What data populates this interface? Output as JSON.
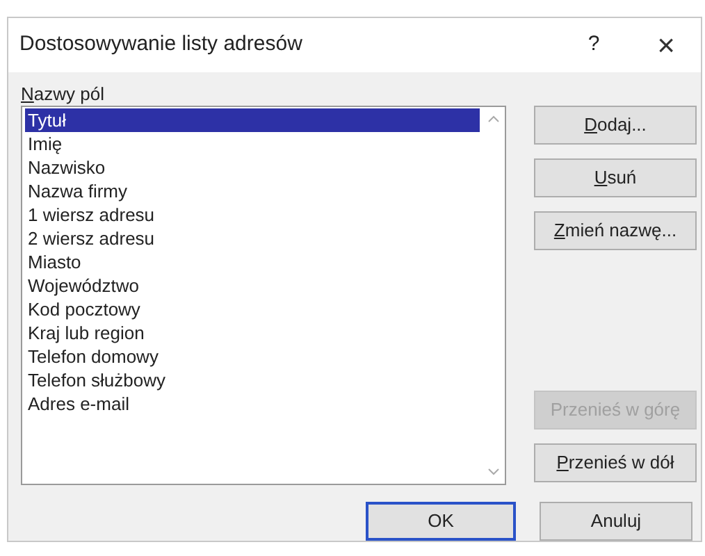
{
  "window": {
    "title": "Dostosowywanie listy adresów",
    "help": "?",
    "close": "×"
  },
  "fields_label": {
    "text": "Nazwy pól",
    "mnemonic": true
  },
  "fields": [
    {
      "label": "Tytuł",
      "selected": true
    },
    {
      "label": "Imię",
      "selected": false
    },
    {
      "label": "Nazwisko",
      "selected": false
    },
    {
      "label": "Nazwa firmy",
      "selected": false
    },
    {
      "label": "1 wiersz adresu",
      "selected": false
    },
    {
      "label": "2 wiersz adresu",
      "selected": false
    },
    {
      "label": "Miasto",
      "selected": false
    },
    {
      "label": "Województwo",
      "selected": false
    },
    {
      "label": "Kod pocztowy",
      "selected": false
    },
    {
      "label": "Kraj lub region",
      "selected": false
    },
    {
      "label": "Telefon domowy",
      "selected": false
    },
    {
      "label": "Telefon służbowy",
      "selected": false
    },
    {
      "label": "Adres e-mail",
      "selected": false
    }
  ],
  "side_buttons": [
    {
      "label": "Dodaj...",
      "mnemonic": true,
      "disabled": false
    },
    {
      "label": "Usuń",
      "mnemonic": true,
      "disabled": false
    },
    {
      "label": "Zmień nazwę...",
      "mnemonic": true,
      "disabled": false
    },
    {
      "label": "Przenieś w górę",
      "mnemonic": false,
      "disabled": true
    },
    {
      "label": "Przenieś w dół",
      "mnemonic": true,
      "disabled": false
    }
  ],
  "footer_buttons": [
    {
      "label": "OK",
      "focused": true
    },
    {
      "label": "Anuluj",
      "focused": false
    }
  ]
}
